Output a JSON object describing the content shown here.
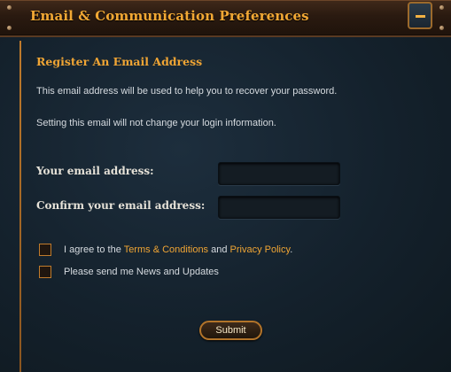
{
  "header": {
    "title": "Email & Communication Preferences",
    "collapse_icon": "minus-icon"
  },
  "section": {
    "title": "Register An Email Address",
    "info_1": "This email address will be used to help you to recover your password.",
    "info_2": "Setting this email will not change your login information."
  },
  "form": {
    "email_label": "Your email address:",
    "email_value": "",
    "confirm_label": "Confirm your email address:",
    "confirm_value": ""
  },
  "agreements": {
    "terms_prefix": "I agree to the ",
    "terms_link": "Terms & Conditions",
    "terms_and": " and ",
    "privacy_link": "Privacy Policy",
    "terms_suffix": ".",
    "terms_checked": false,
    "news_label": "Please send me News and Updates",
    "news_checked": false
  },
  "actions": {
    "submit_label": "Submit"
  },
  "colors": {
    "accent": "#f0a534",
    "background": "#14212c",
    "header": "#2a1a10"
  }
}
